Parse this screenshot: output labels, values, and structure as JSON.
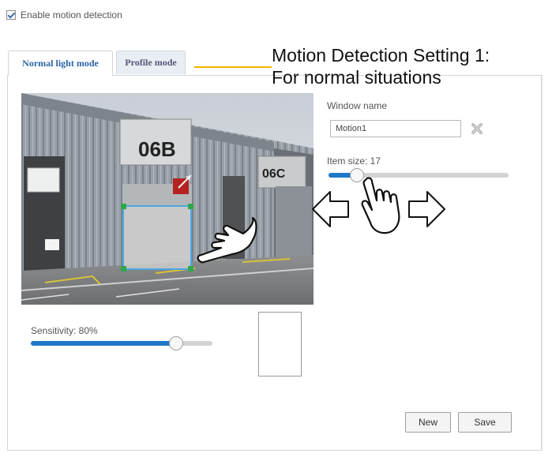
{
  "enable_motion": {
    "checked": true,
    "label": "Enable motion detection"
  },
  "tabs": [
    {
      "label": "Normal light mode",
      "active": true
    },
    {
      "label": "Profile mode",
      "active": false
    }
  ],
  "callout": {
    "line1": "Motion Detection Setting 1:",
    "line2": "For normal situations",
    "line_color": "#f5b400"
  },
  "camera": {
    "building_sign_left": "06B",
    "building_sign_right": "06C"
  },
  "window_name": {
    "label": "Window name",
    "value": "Motion1"
  },
  "item_size": {
    "label": "Item size: 17",
    "value": 17
  },
  "sensitivity": {
    "label": "Sensitivity: 80%",
    "value": 80
  },
  "buttons": {
    "new": "New",
    "save": "Save"
  },
  "colors": {
    "accent": "#1f78c8",
    "tab_active_text": "#2b64a6",
    "window_border": "#4aa8e0",
    "handle": "#2fa84a"
  }
}
